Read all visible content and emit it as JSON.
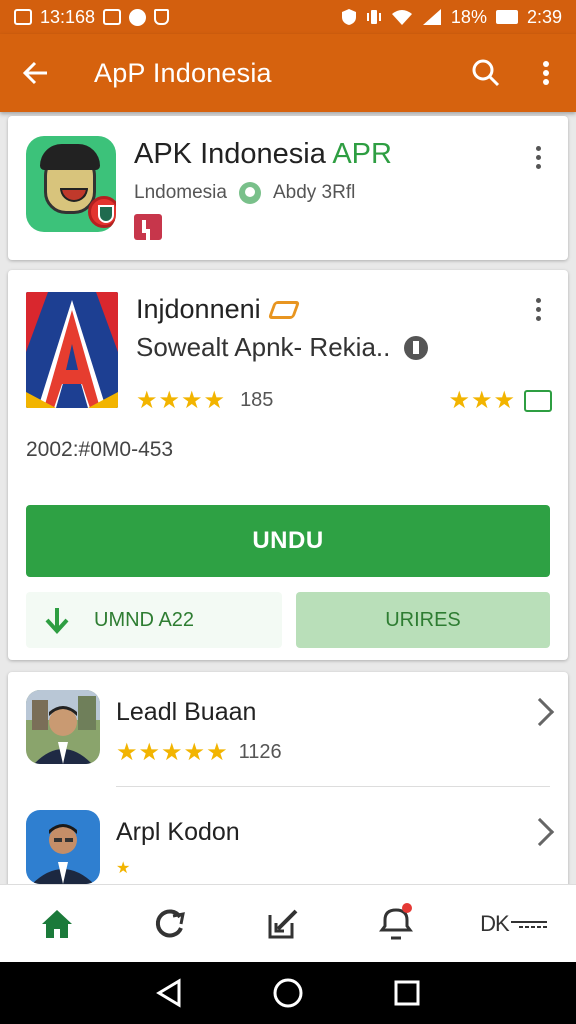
{
  "status_bar": {
    "time_left": "13:168",
    "battery": "18%",
    "time_right": "2:39"
  },
  "app_bar": {
    "title": "ApP Indonesia"
  },
  "featured_card": {
    "name_prefix": "APK Indonesia ",
    "name_highlight": "APR",
    "developer": "Lndomesia",
    "secondary": "Abdy 3Rfl"
  },
  "app_card": {
    "name": "Injdonneni",
    "subtitle": "Sowealt Apnk- Rekia..",
    "stars_left": "★★★★",
    "rating_count": "185",
    "stars_right": "★★★",
    "code": "2002:#0M0-453",
    "install_label": "UNDU",
    "download_label": "UMND A22",
    "secondary_label": "URIRES"
  },
  "related": [
    {
      "name": "Leadl Buaan",
      "stars": "★★★★★",
      "count": "1126"
    },
    {
      "name": "Arpl Kodon",
      "stars": "★",
      "count": ""
    }
  ],
  "bottom_nav": {
    "last_label": "DK"
  },
  "colors": {
    "brand_orange": "#d6620e",
    "install_green": "#2ea144",
    "star": "#f2b400"
  }
}
